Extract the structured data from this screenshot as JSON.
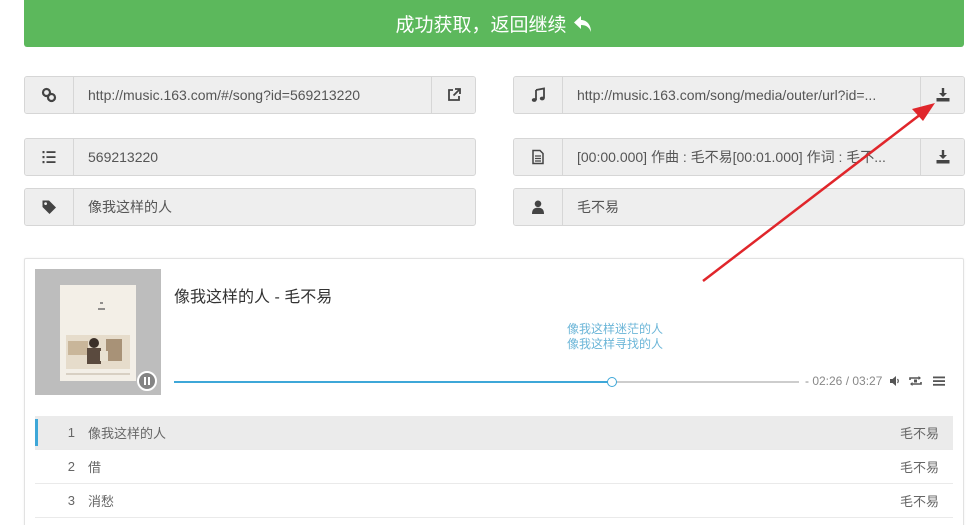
{
  "banner": {
    "text": "成功获取，返回继续"
  },
  "fields": {
    "song_url": "http://music.163.com/#/song?id=569213220",
    "media_url": "http://music.163.com/song/media/outer/url?id=...",
    "song_id": "569213220",
    "lyric": "[00:00.000] 作曲 : 毛不易[00:01.000] 作词 : 毛不...",
    "song_name": "像我这样的人",
    "artist": "毛不易"
  },
  "player": {
    "title": "像我这样的人 - 毛不易",
    "lyric_line_1": "像我这样迷茫的人",
    "lyric_line_2": "像我这样寻找的人",
    "time": "- 02:26 / 03:27",
    "progress": 0.7,
    "accent_color": "#3ea7d8"
  },
  "playlist": [
    {
      "num": "1",
      "name": "像我这样的人",
      "artist": "毛不易"
    },
    {
      "num": "2",
      "name": "借",
      "artist": "毛不易"
    },
    {
      "num": "3",
      "name": "消愁",
      "artist": "毛不易"
    }
  ],
  "icons": {
    "link": "link-icon",
    "external": "external-link-icon",
    "music": "music-note-icon",
    "download": "download-icon",
    "list": "list-numbered-icon",
    "file": "file-text-icon",
    "tag": "tag-icon",
    "user": "user-icon"
  },
  "colors": {
    "banner": "#5cb85c",
    "annotation_arrow": "#e0262b"
  }
}
